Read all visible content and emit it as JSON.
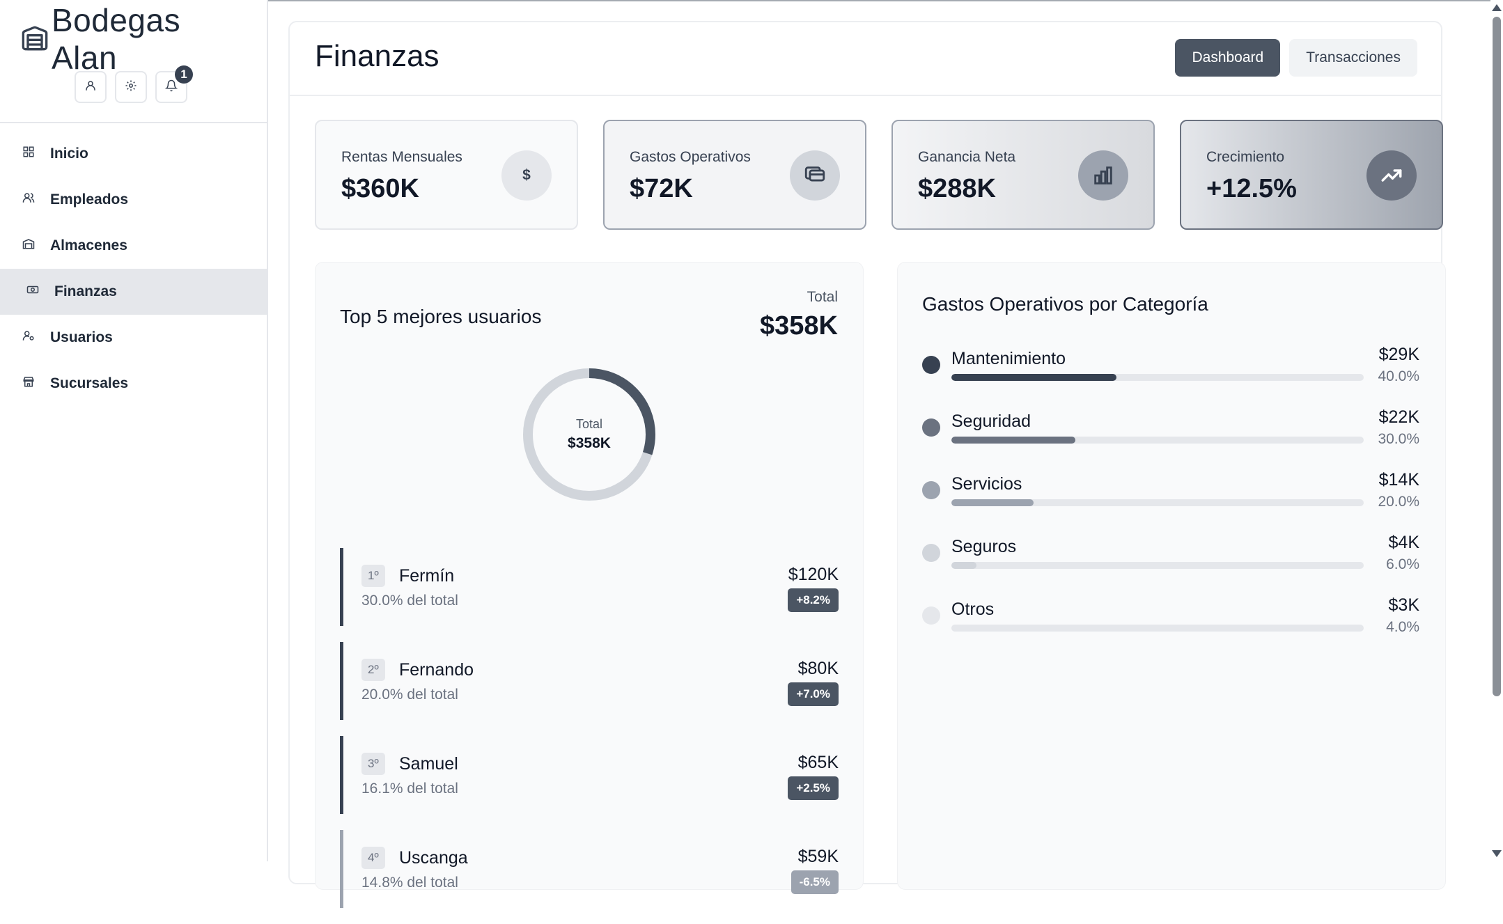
{
  "app": {
    "brand": "Bodegas Alan",
    "notification_count": "1"
  },
  "sidebar": {
    "items": [
      {
        "label": "Inicio",
        "icon": "grid-icon"
      },
      {
        "label": "Empleados",
        "icon": "users-icon"
      },
      {
        "label": "Almacenes",
        "icon": "warehouse-icon"
      },
      {
        "label": "Finanzas",
        "icon": "money-icon",
        "active": true
      },
      {
        "label": "Usuarios",
        "icon": "user-cog-icon"
      },
      {
        "label": "Sucursales",
        "icon": "store-icon"
      }
    ]
  },
  "header": {
    "title": "Finanzas",
    "tabs": [
      {
        "label": "Dashboard",
        "active": true
      },
      {
        "label": "Transacciones",
        "active": false
      }
    ]
  },
  "stats": [
    {
      "label": "Rentas Mensuales",
      "value": "$360K",
      "icon": "dollar-icon",
      "icon_glyph": "$"
    },
    {
      "label": "Gastos Operativos",
      "value": "$72K",
      "icon": "cards-icon"
    },
    {
      "label": "Ganancia Neta",
      "value": "$288K",
      "icon": "bar-chart-icon"
    },
    {
      "label": "Crecimiento",
      "value": "+12.5%",
      "icon": "trending-up-icon"
    }
  ],
  "top_users": {
    "title": "Top 5 mejores usuarios",
    "total_label": "Total",
    "total_value": "$358K",
    "donut_label": "Total",
    "donut_value": "$358K",
    "donut_fraction": 0.3,
    "ranks": [
      {
        "position": "1º",
        "name": "Fermín",
        "share": "30.0% del total",
        "value": "$120K",
        "change": "+8.2%",
        "positive": true
      },
      {
        "position": "2º",
        "name": "Fernando",
        "share": "20.0% del total",
        "value": "$80K",
        "change": "+7.0%",
        "positive": true
      },
      {
        "position": "3º",
        "name": "Samuel",
        "share": "16.1% del total",
        "value": "$65K",
        "change": "+2.5%",
        "positive": true
      },
      {
        "position": "4º",
        "name": "Uscanga",
        "share": "14.8% del total",
        "value": "$59K",
        "change": "-6.5%",
        "positive": false
      }
    ]
  },
  "expenses": {
    "title": "Gastos Operativos por Categoría",
    "categories": [
      {
        "name": "Mantenimiento",
        "value": "$29K",
        "percent": "40.0%",
        "fraction": 0.4,
        "color": "#374151"
      },
      {
        "name": "Seguridad",
        "value": "$22K",
        "percent": "30.0%",
        "fraction": 0.3,
        "color": "#6b7280"
      },
      {
        "name": "Servicios",
        "value": "$14K",
        "percent": "20.0%",
        "fraction": 0.2,
        "color": "#9ca3af"
      },
      {
        "name": "Seguros",
        "value": "$4K",
        "percent": "6.0%",
        "fraction": 0.06,
        "color": "#d1d5db"
      },
      {
        "name": "Otros",
        "value": "$3K",
        "percent": "4.0%",
        "fraction": 0.04,
        "color": "#e5e7eb"
      }
    ]
  }
}
